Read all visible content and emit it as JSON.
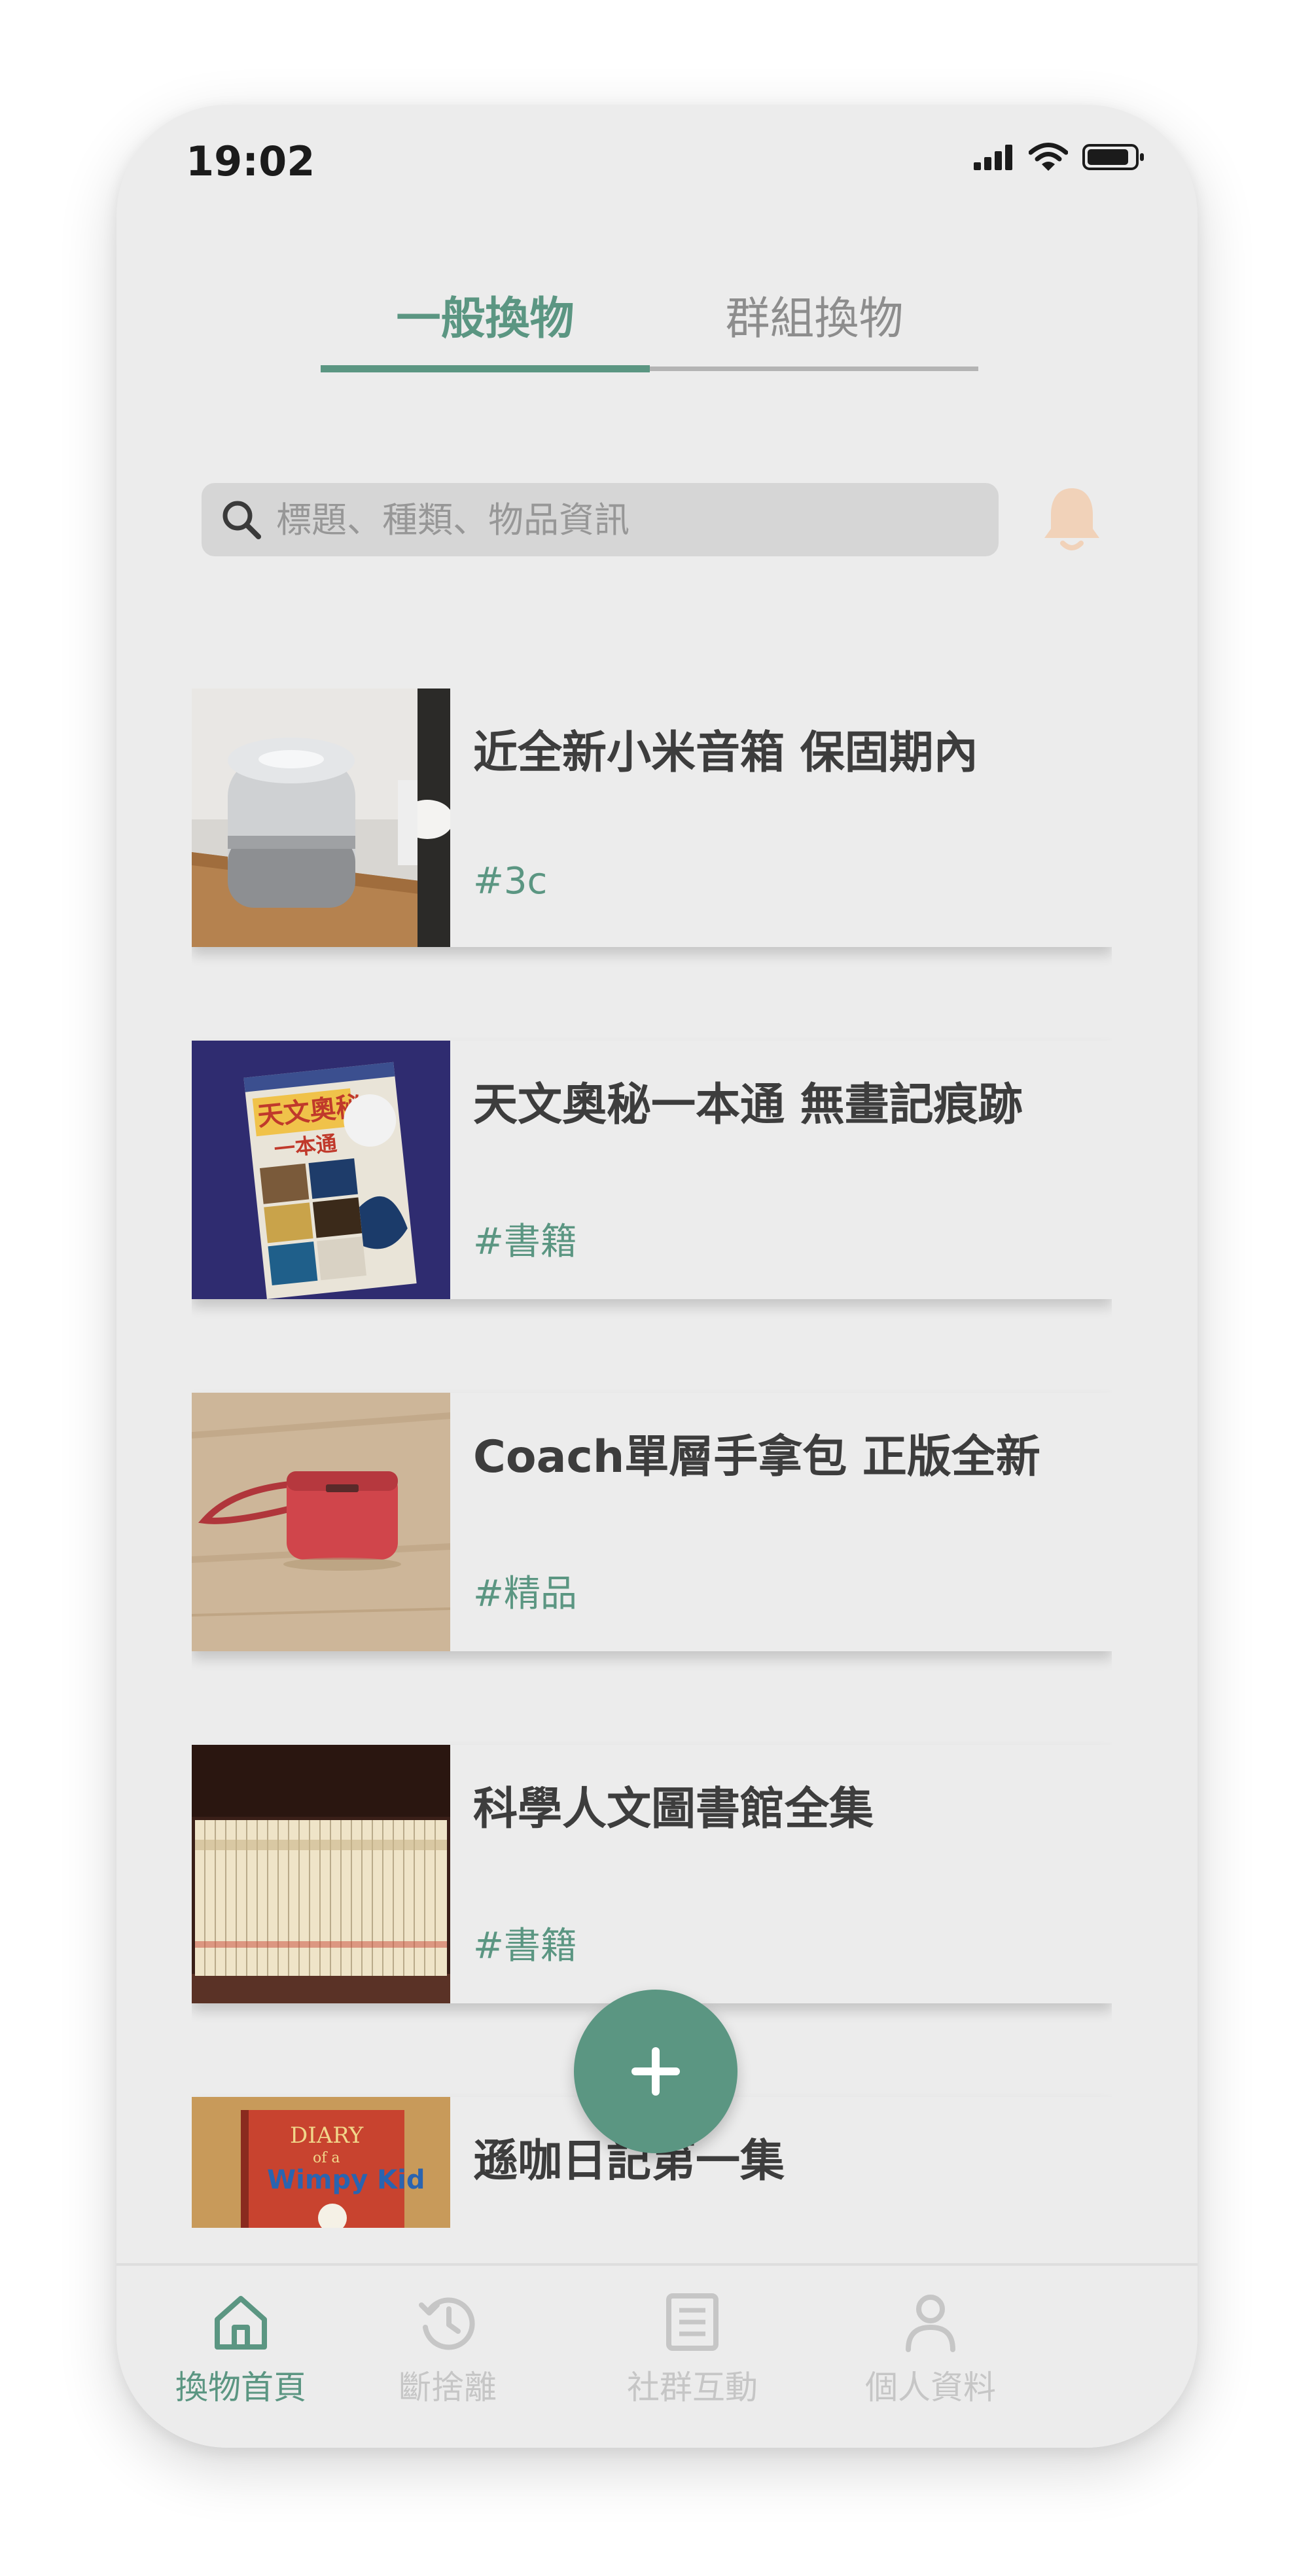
{
  "status_bar": {
    "time": "19:02"
  },
  "tabs": [
    {
      "label": "一般換物",
      "active": true
    },
    {
      "label": "群組換物",
      "active": false
    }
  ],
  "search": {
    "placeholder": "標題、種類、物品資訊"
  },
  "items": [
    {
      "title": "近全新小米音箱 保固期內",
      "tag": "#3c"
    },
    {
      "title": "天文奧秘一本通 無畫記痕跡",
      "tag": "#書籍",
      "image_text": {
        "line1": "天文奧秘",
        "line2": "一本通"
      }
    },
    {
      "title": "Coach單層手拿包 正版全新",
      "tag": "#精品"
    },
    {
      "title": "科學人文圖書館全集",
      "tag": "#書籍"
    },
    {
      "title": "遜咖日記第一集",
      "tag": "",
      "image_text": {
        "line1": "DIARY",
        "line2": "of a",
        "line3": "Wimpy Kid"
      }
    }
  ],
  "bottom_nav": [
    {
      "label": "換物首頁",
      "icon": "home-icon",
      "active": true
    },
    {
      "label": "斷捨離",
      "icon": "history-icon",
      "active": false
    },
    {
      "label": "社群互動",
      "icon": "document-icon",
      "active": false
    },
    {
      "label": "個人資料",
      "icon": "person-icon",
      "active": false
    }
  ],
  "colors": {
    "accent": "#5b9682",
    "background": "#ececec",
    "bell": "#f1d2b9",
    "inactive": "#c6c6c6"
  }
}
